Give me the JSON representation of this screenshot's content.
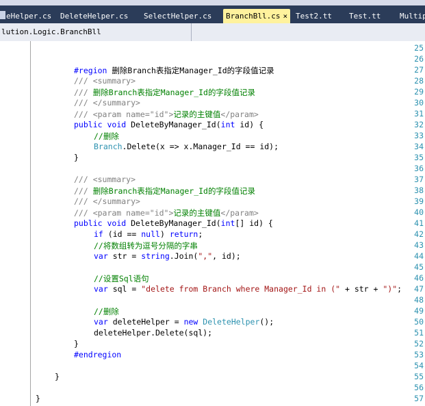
{
  "tabs": [
    {
      "label": "eHelper.cs",
      "active": false
    },
    {
      "label": "DeleteHelper.cs",
      "active": false
    },
    {
      "label": "SelectHelper.cs",
      "active": false
    },
    {
      "label": "BranchBll.cs",
      "active": true,
      "close": "×"
    },
    {
      "label": "Test2.tt",
      "active": false
    },
    {
      "label": "Test.tt",
      "active": false
    },
    {
      "label": "Multipl",
      "active": false
    }
  ],
  "navbar": {
    "namespace": "lution.Logic.BranchBll"
  },
  "code": {
    "line_numbers": [
      "25",
      "26",
      "27",
      "28",
      "29",
      "30",
      "31",
      "32",
      "33",
      "34",
      "35",
      "36",
      "37",
      "38",
      "39",
      "40",
      "41",
      "42",
      "43",
      "44",
      "45",
      "46",
      "47",
      "48",
      "49",
      "50",
      "51",
      "52",
      "53",
      "54",
      "55",
      "56",
      "57"
    ],
    "l27": {
      "kw": "#region",
      "text": " 删除Branch表指定Manager_Id的字段值记录"
    },
    "l28": {
      "xml": "/// <summary>"
    },
    "l29": {
      "prefix": "/// ",
      "text": "删除Branch表指定Manager_Id的字段值记录"
    },
    "l30": {
      "xml": "/// </summary>"
    },
    "l31": {
      "prefix": "/// <param name=\"id\">",
      "text": "记录的主键值",
      "suffix": "</param>"
    },
    "l32": {
      "kw1": "public",
      "kw2": "void",
      "name": " DeleteByManager_Id(",
      "kw3": "int",
      "rest": " id) {"
    },
    "l33": {
      "comment": "//删除"
    },
    "l34": {
      "type": "Branch",
      "rest": ".Delete(x => x.Manager_Id == id);"
    },
    "l35": {
      "text": "}"
    },
    "l37": {
      "xml": "/// <summary>"
    },
    "l38": {
      "prefix": "/// ",
      "text": "删除Branch表指定Manager_Id的字段值记录"
    },
    "l39": {
      "xml": "/// </summary>"
    },
    "l40": {
      "prefix": "/// <param name=\"id\">",
      "text": "记录的主键值",
      "suffix": "</param>"
    },
    "l41": {
      "kw1": "public",
      "kw2": "void",
      "name": " DeleteByManager_Id(",
      "kw3": "int",
      "rest": "[] id) {"
    },
    "l42": {
      "kw1": "if",
      "mid": " (id == ",
      "kw2": "null",
      "mid2": ") ",
      "kw3": "return",
      "end": ";"
    },
    "l43": {
      "comment": "//将数组转为逗号分隔的字串"
    },
    "l44": {
      "kw1": "var",
      "mid": " str = ",
      "kw2": "string",
      "rest": ".Join(",
      "str": "\",\"",
      "end": ", id);"
    },
    "l46": {
      "comment": "//设置Sql语句"
    },
    "l47": {
      "kw1": "var",
      "mid": " sql = ",
      "str1": "\"delete from Branch where Manager_Id in (\"",
      "mid2": " + str + ",
      "str2": "\")\"",
      "end": ";"
    },
    "l49": {
      "comment": "//删除"
    },
    "l50": {
      "kw1": "var",
      "mid": " deleteHelper = ",
      "kw2": "new",
      "sp": " ",
      "type": "DeleteHelper",
      "end": "();"
    },
    "l51": {
      "text": "deleteHelper.Delete(sql);"
    },
    "l52": {
      "text": "}"
    },
    "l53": {
      "kw": "#endregion"
    },
    "l55": {
      "text": "}"
    },
    "l57": {
      "text": "}"
    }
  },
  "colors": {
    "keyword": "#0000ff",
    "comment": "#008000",
    "xml_doc": "#808080",
    "type": "#2b91af",
    "string": "#a31515",
    "active_tab": "#fff29d",
    "tab_strip": "#2b3c59"
  }
}
